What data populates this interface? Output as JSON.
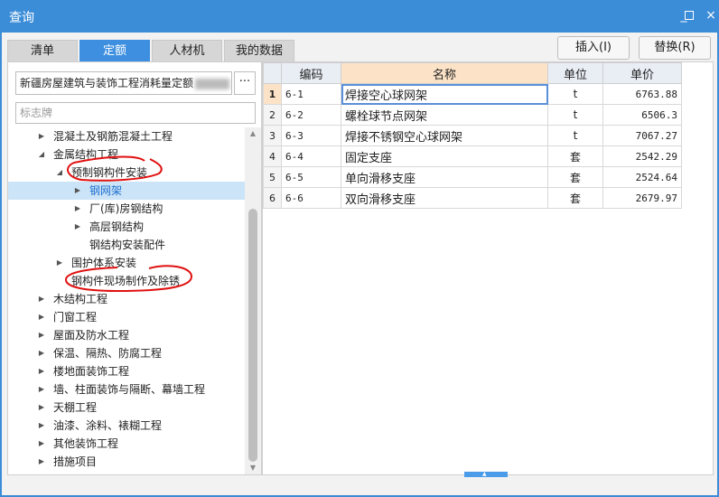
{
  "window": {
    "title": "查询",
    "minimize_glyph": "_",
    "close_glyph": "×"
  },
  "tabs": [
    {
      "label": "清单",
      "active": false
    },
    {
      "label": "定额",
      "active": true
    },
    {
      "label": "人材机",
      "active": false
    },
    {
      "label": "我的数据",
      "active": false
    }
  ],
  "buttons": {
    "insert": "插入(I)",
    "replace": "替换(R)"
  },
  "library": {
    "selected": "新疆房屋建筑与装饰工程消耗量定额",
    "more": "···"
  },
  "search": {
    "value": "",
    "placeholder": "标志牌"
  },
  "tree": [
    {
      "label": "混凝土及钢筋混凝土工程",
      "arrow": "▶"
    },
    {
      "label": "金属结构工程",
      "arrow": "◢"
    },
    {
      "label": "预制钢构件安装",
      "arrow": "◢"
    },
    {
      "label": "钢网架",
      "arrow": "▶",
      "selected": true
    },
    {
      "label": "厂(库)房钢结构",
      "arrow": "▶"
    },
    {
      "label": "高层钢结构",
      "arrow": "▶"
    },
    {
      "label": "钢结构安装配件",
      "arrow": ""
    },
    {
      "label": "围护体系安装",
      "arrow": "▶"
    },
    {
      "label": "钢构件现场制作及除锈",
      "arrow": ""
    },
    {
      "label": "木结构工程",
      "arrow": "▶"
    },
    {
      "label": "门窗工程",
      "arrow": "▶"
    },
    {
      "label": "屋面及防水工程",
      "arrow": "▶"
    },
    {
      "label": "保温、隔热、防腐工程",
      "arrow": "▶"
    },
    {
      "label": "楼地面装饰工程",
      "arrow": "▶"
    },
    {
      "label": "墙、柱面装饰与隔断、幕墙工程",
      "arrow": "▶"
    },
    {
      "label": "天棚工程",
      "arrow": "▶"
    },
    {
      "label": "油漆、涂料、裱糊工程",
      "arrow": "▶"
    },
    {
      "label": "其他装饰工程",
      "arrow": "▶"
    },
    {
      "label": "措施项目",
      "arrow": "▶"
    }
  ],
  "scrollbar": {
    "up": "▲",
    "down": "▼"
  },
  "grid": {
    "headers": {
      "code": "编码",
      "name": "名称",
      "unit": "单位",
      "price": "单价"
    },
    "rows": [
      {
        "no": "1",
        "code": "6-1",
        "name": "焊接空心球网架",
        "unit": "t",
        "price": "6763.88"
      },
      {
        "no": "2",
        "code": "6-2",
        "name": "螺栓球节点网架",
        "unit": "t",
        "price": "6506.3"
      },
      {
        "no": "3",
        "code": "6-3",
        "name": "焊接不锈钢空心球网架",
        "unit": "t",
        "price": "7067.27"
      },
      {
        "no": "4",
        "code": "6-4",
        "name": "固定支座",
        "unit": "套",
        "price": "2542.29"
      },
      {
        "no": "5",
        "code": "6-5",
        "name": "单向滑移支座",
        "unit": "套",
        "price": "2524.64"
      },
      {
        "no": "6",
        "code": "6-6",
        "name": "双向滑移支座",
        "unit": "套",
        "price": "2679.97"
      }
    ]
  },
  "splitter": {
    "glyph": "▲"
  },
  "colors": {
    "titlebar": "#3C8DD8",
    "active_tab": "#3E8FE0",
    "selected_row": "#CCE4F7",
    "annotation": "#E01010"
  }
}
